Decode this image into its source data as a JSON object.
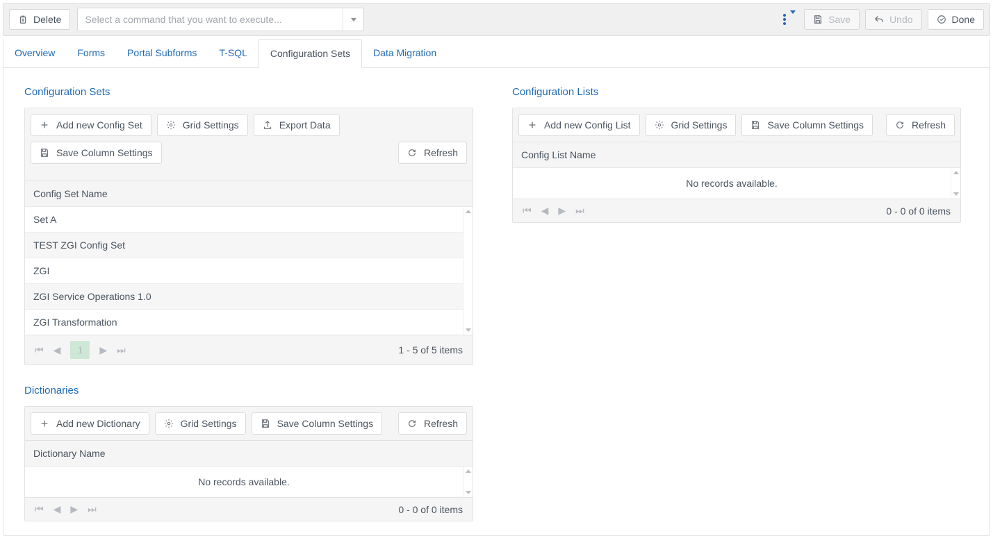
{
  "toolbar": {
    "delete_label": "Delete",
    "command_placeholder": "Select a command that you want to execute...",
    "save_label": "Save",
    "undo_label": "Undo",
    "done_label": "Done"
  },
  "tabs": [
    {
      "label": "Overview"
    },
    {
      "label": "Forms"
    },
    {
      "label": "Portal Subforms"
    },
    {
      "label": "T-SQL"
    },
    {
      "label": "Configuration Sets"
    },
    {
      "label": "Data Migration"
    }
  ],
  "panels": {
    "config_sets": {
      "title": "Configuration Sets",
      "buttons": {
        "add": "Add new Config Set",
        "grid_settings": "Grid Settings",
        "export": "Export Data",
        "save_cols": "Save Column Settings",
        "refresh": "Refresh"
      },
      "column_header": "Config Set Name",
      "rows": [
        "Set A",
        "TEST ZGI Config Set",
        "ZGI",
        "ZGI Service Operations 1.0",
        "ZGI Transformation"
      ],
      "pager": {
        "page": "1",
        "info": "1 - 5 of 5 items"
      }
    },
    "dictionaries": {
      "title": "Dictionaries",
      "buttons": {
        "add": "Add new Dictionary",
        "grid_settings": "Grid Settings",
        "save_cols": "Save Column Settings",
        "refresh": "Refresh"
      },
      "column_header": "Dictionary Name",
      "no_records": "No records available.",
      "pager": {
        "info": "0 - 0 of 0 items"
      }
    },
    "config_lists": {
      "title": "Configuration Lists",
      "buttons": {
        "add": "Add new Config List",
        "grid_settings": "Grid Settings",
        "save_cols": "Save Column Settings",
        "refresh": "Refresh"
      },
      "column_header": "Config List Name",
      "no_records": "No records available.",
      "pager": {
        "info": "0 - 0 of 0 items"
      }
    }
  }
}
